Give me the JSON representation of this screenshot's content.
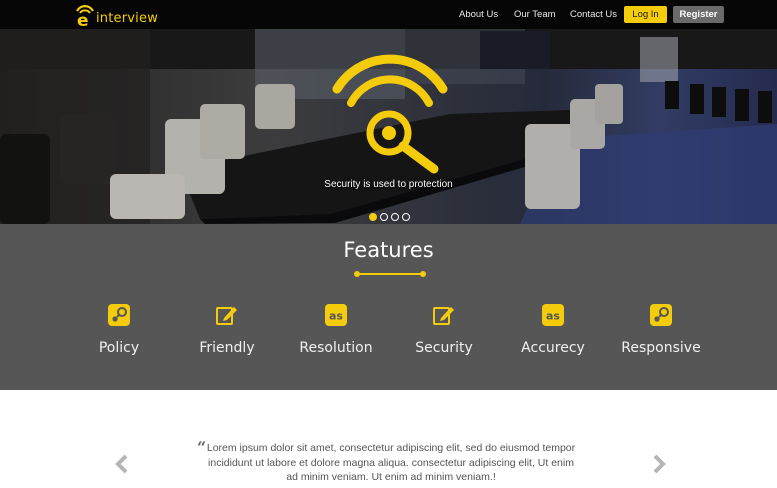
{
  "brand": {
    "name": "interview",
    "accent": "#f5cc0c"
  },
  "nav": {
    "links": [
      "About Us",
      "Our Team",
      "Contact Us"
    ],
    "login_label": "Log In",
    "register_label": "Register"
  },
  "hero": {
    "caption": "Security is used to protection",
    "icon": "wifi-search-icon",
    "slides_total": 4,
    "active_slide": 1
  },
  "features": {
    "title": "Features",
    "items": [
      {
        "label": "Policy",
        "icon": "steam-icon"
      },
      {
        "label": "Friendly",
        "icon": "edit-icon"
      },
      {
        "label": "Resolution",
        "icon": "lastfm-icon"
      },
      {
        "label": "Security",
        "icon": "edit-icon"
      },
      {
        "label": "Accurecy",
        "icon": "lastfm-icon"
      },
      {
        "label": "Responsive",
        "icon": "steam-icon"
      }
    ]
  },
  "testimonial": {
    "quote_icon": "quote-icon",
    "text": "Lorem ipsum dolor sit amet, consectetur adipiscing elit, sed do eiusmod tempor incididunt ut labore et dolore magna aliqua. consectetur adipiscing elit, Ut enim ad minim veniam. Ut enim ad minim veniam.!",
    "prev_icon": "chevron-left-icon",
    "next_icon": "chevron-right-icon"
  }
}
